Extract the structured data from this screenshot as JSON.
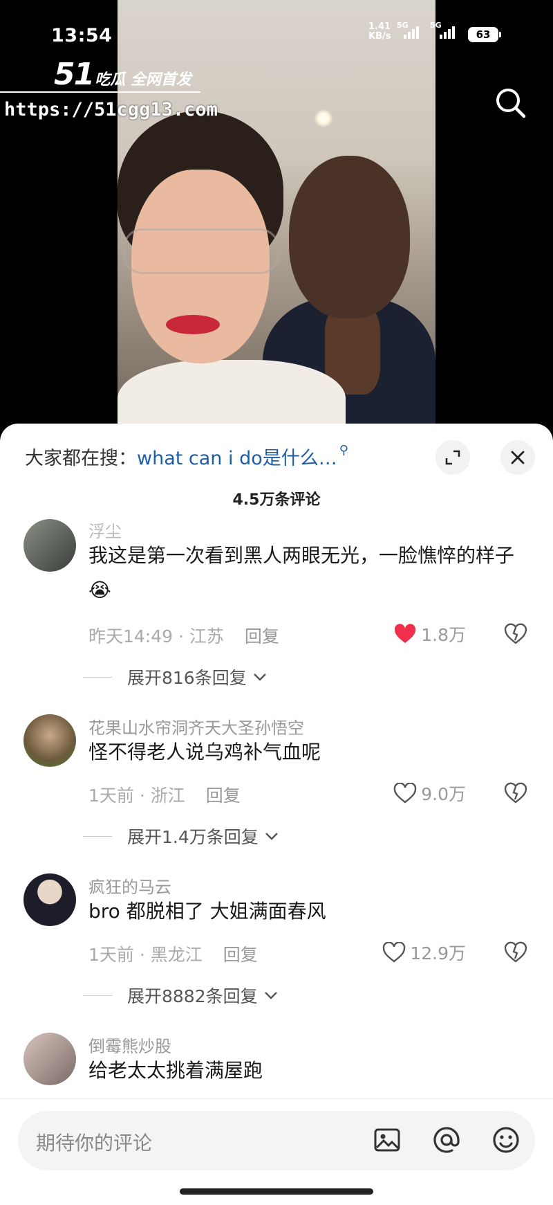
{
  "status_bar": {
    "time": "13:54",
    "net_speed": "1.41",
    "net_unit": "KB/s",
    "sig1_label": "5G",
    "sig2_label": "5G",
    "battery": "63"
  },
  "brand": {
    "number": "51",
    "text": "吃瓜 全网首发",
    "url": "https://51cgg13.com"
  },
  "hot_search": {
    "prefix": "大家都在搜：",
    "keyword": "what can i do是什么…"
  },
  "comment_count": "4.5万条评论",
  "comments": [
    {
      "user": "浮尘",
      "text": "我这是第一次看到黑人两眼无光，一脸憔悴的样子",
      "emoji": "😭",
      "date": "昨天14:49",
      "location": "江苏",
      "reply_label": "回复",
      "likes": "1.8万",
      "liked": true,
      "expand": "展开816条回复"
    },
    {
      "user": "花果山水帘洞齐天大圣孙悟空",
      "text": "怪不得老人说乌鸡补气血呢",
      "date": "1天前",
      "location": "浙江",
      "reply_label": "回复",
      "likes": "9.0万",
      "liked": false,
      "expand": "展开1.4万条回复"
    },
    {
      "user": "疯狂的马云",
      "text": "bro 都脱相了 大姐满面春风",
      "date": "1天前",
      "location": "黑龙江",
      "reply_label": "回复",
      "likes": "12.9万",
      "liked": false,
      "expand": "展开8882条回复"
    },
    {
      "user": "倒霉熊炒股",
      "text": "给老太太挑着满屋跑"
    }
  ],
  "input": {
    "placeholder": "期待你的评论"
  },
  "colors": {
    "like_red": "#f0304a",
    "keyword_blue": "#1e5ea8"
  },
  "icons": [
    "search-icon",
    "expand-icon",
    "close-icon",
    "heart-icon",
    "dislike-icon",
    "chevron-down-icon",
    "image-icon",
    "at-icon",
    "emoji-icon"
  ]
}
